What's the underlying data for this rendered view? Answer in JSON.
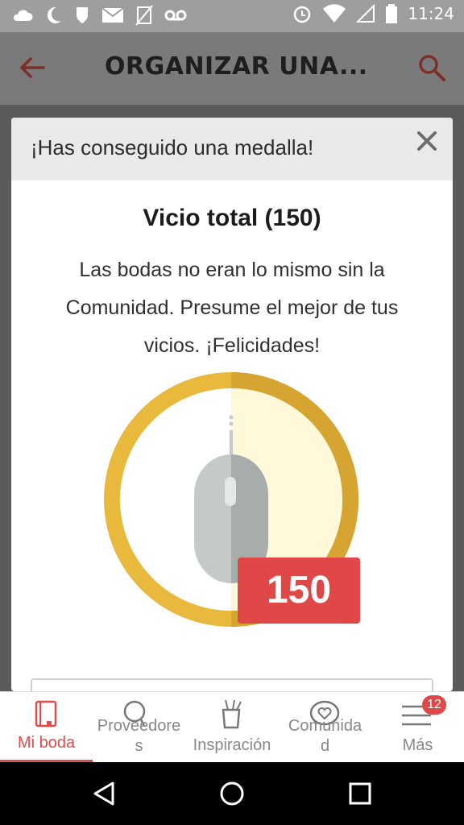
{
  "statusbar": {
    "time": "11:24",
    "left_icons": [
      "cloud-icon",
      "moon-icon",
      "shield-icon",
      "mail-icon",
      "no-sim-icon",
      "voicemail-icon"
    ],
    "right_icons": [
      "alarm-icon",
      "wifi-icon",
      "signal-icon",
      "battery-icon"
    ]
  },
  "appbar": {
    "title": "ORGANIZAR UNA...",
    "back_icon": "arrow-left-icon",
    "search_icon": "search-icon"
  },
  "modal": {
    "header_title": "¡Has conseguido una medalla!",
    "close_label": "×",
    "medal_title": "Vicio total (150)",
    "medal_description": "Las bodas no eran lo mismo sin la Comunidad. Presume el mejor de tus vicios. ¡Felicidades!",
    "badge_value": "150",
    "colors": {
      "ring": "#e8b93d",
      "ring_shadow": "#d6a431",
      "inner_light": "#fff9d9",
      "mouse_light": "#c5c9c8",
      "mouse_dark": "#a7adab",
      "badge": "#e04848"
    }
  },
  "tabbar": {
    "tabs": [
      {
        "label": "Mi boda",
        "icon": "notebook-icon",
        "active": true
      },
      {
        "label": "Proveedore\ns",
        "icon": "search-circle-icon",
        "active": false
      },
      {
        "label": "Inspiración",
        "icon": "cup-icon",
        "active": false
      },
      {
        "label": "Comunida\nd",
        "icon": "heart-chat-icon",
        "active": false
      },
      {
        "label": "Más",
        "icon": "menu-icon",
        "active": false
      }
    ],
    "notification_count": "12",
    "active_color": "#e14b4b"
  },
  "navbar": {
    "back": "back-triangle-icon",
    "home": "home-circle-icon",
    "recents": "recents-square-icon"
  }
}
